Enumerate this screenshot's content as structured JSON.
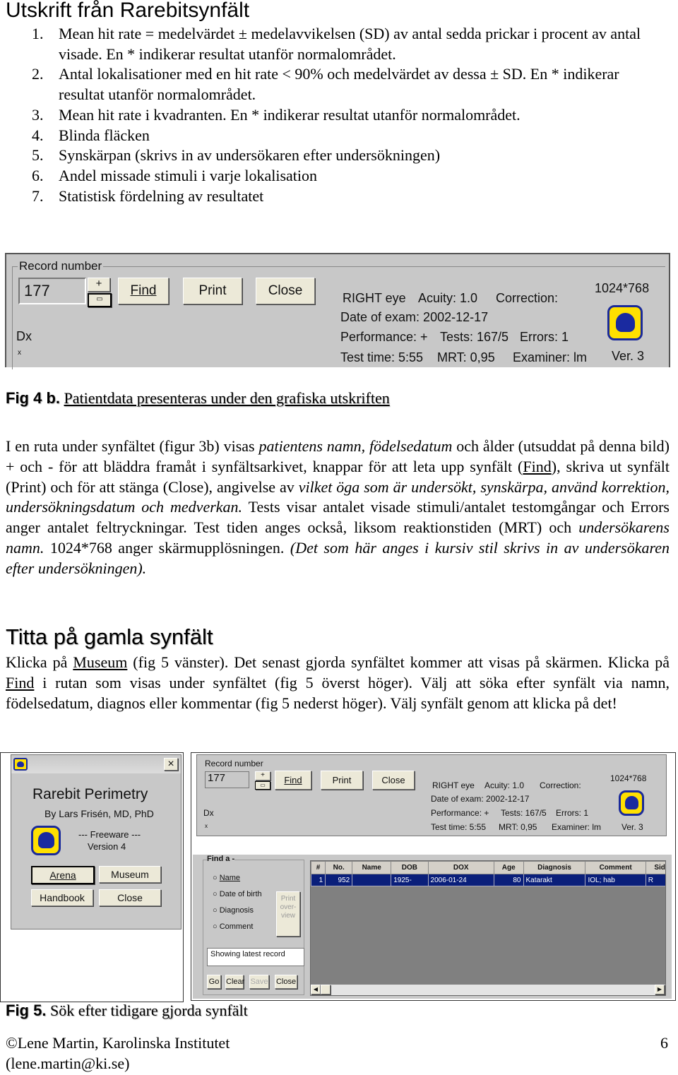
{
  "title": "Utskrift från Rarebitsynfält",
  "list": [
    {
      "n": "1.",
      "text": "Mean hit rate = medelvärdet ± medelavvikelsen (SD) av antal sedda prickar i procent av antal visade. En * indikerar resultat utanför normalområdet."
    },
    {
      "n": "2.",
      "text": "Antal lokalisationer med en hit rate < 90% och medelvärdet av dessa ± SD. En * indikerar resultat utanför normalområdet."
    },
    {
      "n": "3.",
      "text": "Mean hit rate i kvadranten. En * indikerar resultat utanför normalområdet."
    },
    {
      "n": "4.",
      "text": "Blinda fläcken"
    },
    {
      "n": "5.",
      "text": "Synskärpan (skrivs in av undersökaren efter undersökningen)"
    },
    {
      "n": "6.",
      "text": "Andel missade stimuli i varje lokalisation"
    },
    {
      "n": "7.",
      "text": "Statistisk fördelning av resultatet"
    }
  ],
  "record_panel": {
    "group_label": "Record number",
    "record": "177",
    "plus": "+",
    "find": "Find",
    "print": "Print",
    "close": "Close",
    "dx": "Dx",
    "x": "x",
    "line1a": "RIGHT eye",
    "line1b": "Acuity: 1.0",
    "line1c": "Correction:",
    "line2": "Date of exam: 2002-12-17",
    "line3a": "Performance: +",
    "line3b": "Tests: 167/5",
    "line3c": "Errors: 1",
    "line4a": "Test time: 5:55",
    "line4b": "MRT: 0,95",
    "line4c": "Examiner:  lm",
    "resolution": "1024*768",
    "version": "Ver. 3",
    "logo_icon": "rabbit-icon"
  },
  "fig4": {
    "label": "Fig 4 b.",
    "text": "Patientdata presenteras under den grafiska utskriften"
  },
  "para1": {
    "t1": "I en ruta under synfältet (figur 3b) visas ",
    "i1": "patientens namn, födelsedatum",
    "t2": " och ålder (utsuddat på denna bild) + och - för att bläddra framåt i synfältsarkivet, knappar för att leta upp synfält (",
    "find": "Find",
    "t3": "), skriva ut synfält (",
    "print": "Print",
    "t4": ") och för att stänga (",
    "close": "Close",
    "t5": "), angivelse av ",
    "i2": "vilket öga som är undersökt, synskärpa, använd korrektion, undersökningsdatum och medverkan.",
    "t6": " Tests visar antalet visade stimuli/antalet testomgångar och Errors anger antalet feltryckningar. Test tiden anges också, liksom reaktionstiden (MRT) och ",
    "i3": "undersökarens namn.",
    "t7": " 1024*768 anger skärmupplösningen. ",
    "i4": "(Det som här anges i kursiv stil skrivs in av undersökaren efter undersökningen)."
  },
  "heading2": "Titta på gamla synfält",
  "para2": {
    "t1": "Klicka på ",
    "museum": "Museum",
    "t2": " (fig 5 vänster). Det senast gjorda synfältet kommer att visas på skärmen. Klicka på ",
    "find": "Find",
    "t3": " i rutan som visas under synfältet (fig 5 överst höger). Välj att söka efter synfält via namn, födelsedatum, diagnos eller kommentar (fig 5 nederst höger). Välj synfält genom att klicka på det!"
  },
  "splash": {
    "title": "Rarebit Perimetry",
    "author": "By Lars Frisén, MD, PhD",
    "freeware": "--- Freeware ---",
    "version": "Version 4",
    "arena": "Arena",
    "museum": "Museum",
    "handbook": "Handbook",
    "close": "Close",
    "close_x": "×"
  },
  "find_panel": {
    "group": "Find a -",
    "options": [
      "Name",
      "Date of birth",
      "Diagnosis",
      "Comment"
    ],
    "print_overview": "Print over-view",
    "status": "Showing latest record",
    "buttons": [
      "Go",
      "Clear",
      "Save",
      "Close"
    ],
    "columns": [
      "#",
      "No.",
      "Name",
      "DOB",
      "DOX",
      "Age",
      "Diagnosis",
      "Comment",
      "Side"
    ],
    "rows": [
      [
        "1",
        "952",
        "",
        "1925-",
        "2006-01-24",
        "80",
        "Katarakt",
        "IOL; hab",
        "R"
      ]
    ]
  },
  "fig5": {
    "label": "Fig 5.",
    "text": "Sök efter tidigare gjorda synfält"
  },
  "footer": {
    "line1": "©Lene Martin, Karolinska Institutet",
    "line2": "(lene.martin@ki.se)",
    "page": "6"
  }
}
